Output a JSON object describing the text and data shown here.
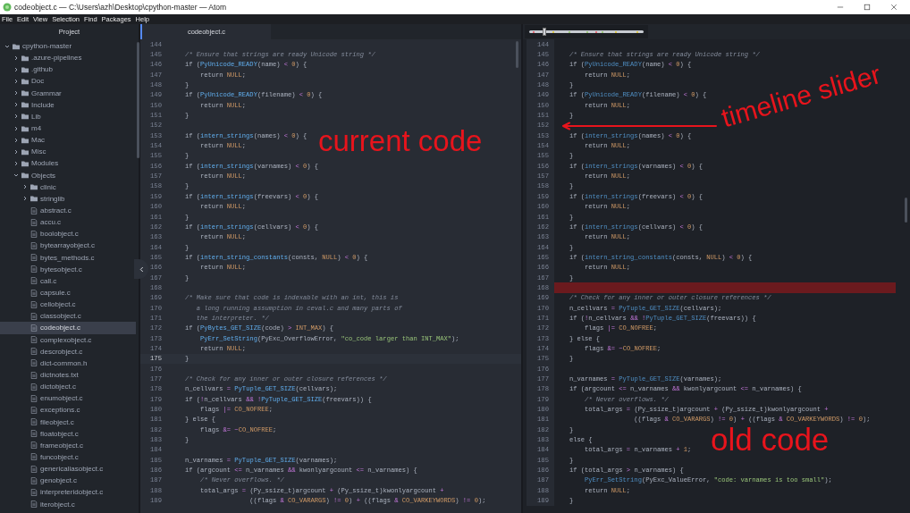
{
  "window": {
    "title": "codeobject.c — C:\\Users\\azh\\Desktop\\cpython-master — Atom"
  },
  "menu": [
    "File",
    "Edit",
    "View",
    "Selection",
    "Find",
    "Packages",
    "Help"
  ],
  "sidebar": {
    "title": "Project",
    "tree": [
      {
        "name": "cpython-master",
        "kind": "folder",
        "expanded": true,
        "selected": false,
        "children": [
          {
            "name": ".azure-pipelines",
            "kind": "folder",
            "expanded": false,
            "selected": false
          },
          {
            "name": ".github",
            "kind": "folder",
            "expanded": false,
            "selected": false
          },
          {
            "name": "Doc",
            "kind": "folder",
            "expanded": false,
            "selected": false
          },
          {
            "name": "Grammar",
            "kind": "folder",
            "expanded": false,
            "selected": false
          },
          {
            "name": "Include",
            "kind": "folder",
            "expanded": false,
            "selected": false
          },
          {
            "name": "Lib",
            "kind": "folder",
            "expanded": false,
            "selected": false
          },
          {
            "name": "m4",
            "kind": "folder",
            "expanded": false,
            "selected": false
          },
          {
            "name": "Mac",
            "kind": "folder",
            "expanded": false,
            "selected": false
          },
          {
            "name": "Misc",
            "kind": "folder",
            "expanded": false,
            "selected": false
          },
          {
            "name": "Modules",
            "kind": "folder",
            "expanded": false,
            "selected": false
          },
          {
            "name": "Objects",
            "kind": "folder",
            "expanded": true,
            "selected": false,
            "children": [
              {
                "name": "clinic",
                "kind": "folder",
                "expanded": false,
                "selected": false
              },
              {
                "name": "stringlib",
                "kind": "folder",
                "expanded": false,
                "selected": false
              },
              {
                "name": "abstract.c",
                "kind": "file",
                "selected": false
              },
              {
                "name": "accu.c",
                "kind": "file",
                "selected": false
              },
              {
                "name": "boolobject.c",
                "kind": "file",
                "selected": false
              },
              {
                "name": "bytearrayobject.c",
                "kind": "file",
                "selected": false
              },
              {
                "name": "bytes_methods.c",
                "kind": "file",
                "selected": false
              },
              {
                "name": "bytesobject.c",
                "kind": "file",
                "selected": false
              },
              {
                "name": "call.c",
                "kind": "file",
                "selected": false
              },
              {
                "name": "capsule.c",
                "kind": "file",
                "selected": false
              },
              {
                "name": "cellobject.c",
                "kind": "file",
                "selected": false
              },
              {
                "name": "classobject.c",
                "kind": "file",
                "selected": false
              },
              {
                "name": "codeobject.c",
                "kind": "file",
                "selected": true
              },
              {
                "name": "complexobject.c",
                "kind": "file",
                "selected": false
              },
              {
                "name": "descrobject.c",
                "kind": "file",
                "selected": false
              },
              {
                "name": "dict-common.h",
                "kind": "file",
                "selected": false
              },
              {
                "name": "dictnotes.txt",
                "kind": "file",
                "selected": false
              },
              {
                "name": "dictobject.c",
                "kind": "file",
                "selected": false
              },
              {
                "name": "enumobject.c",
                "kind": "file",
                "selected": false
              },
              {
                "name": "exceptions.c",
                "kind": "file",
                "selected": false
              },
              {
                "name": "fileobject.c",
                "kind": "file",
                "selected": false
              },
              {
                "name": "floatobject.c",
                "kind": "file",
                "selected": false
              },
              {
                "name": "frameobject.c",
                "kind": "file",
                "selected": false
              },
              {
                "name": "funcobject.c",
                "kind": "file",
                "selected": false
              },
              {
                "name": "genericaliasobject.c",
                "kind": "file",
                "selected": false
              },
              {
                "name": "genobject.c",
                "kind": "file",
                "selected": false
              },
              {
                "name": "interpreteridobject.c",
                "kind": "file",
                "selected": false
              },
              {
                "name": "iterobject.c",
                "kind": "file",
                "selected": false
              }
            ]
          }
        ]
      }
    ]
  },
  "editor": {
    "tab": "codeobject.c",
    "lines": [
      {
        "n": "144",
        "kind": "blank",
        "current": false
      },
      {
        "n": "145",
        "kind": "comment",
        "text": "/* Ensure that strings are ready Unicode string */",
        "current": false
      },
      {
        "n": "146",
        "kind": "code",
        "text": "if (PyUnicode_READY(name) < 0) {",
        "current": false
      },
      {
        "n": "147",
        "kind": "code",
        "text": "    return NULL;",
        "current": false
      },
      {
        "n": "148",
        "kind": "code",
        "text": "}",
        "current": false
      },
      {
        "n": "149",
        "kind": "code",
        "text": "if (PyUnicode_READY(filename) < 0) {",
        "current": false
      },
      {
        "n": "150",
        "kind": "code",
        "text": "    return NULL;",
        "current": false
      },
      {
        "n": "151",
        "kind": "code",
        "text": "}",
        "current": false
      },
      {
        "n": "152",
        "kind": "blank",
        "current": false
      },
      {
        "n": "153",
        "kind": "code",
        "text": "if (intern_strings(names) < 0) {",
        "current": false
      },
      {
        "n": "154",
        "kind": "code",
        "text": "    return NULL;",
        "current": false
      },
      {
        "n": "155",
        "kind": "code",
        "text": "}",
        "current": false
      },
      {
        "n": "156",
        "kind": "code",
        "text": "if (intern_strings(varnames) < 0) {",
        "current": false
      },
      {
        "n": "157",
        "kind": "code",
        "text": "    return NULL;",
        "current": false
      },
      {
        "n": "158",
        "kind": "code",
        "text": "}",
        "current": false
      },
      {
        "n": "159",
        "kind": "code",
        "text": "if (intern_strings(freevars) < 0) {",
        "current": false
      },
      {
        "n": "160",
        "kind": "code",
        "text": "    return NULL;",
        "current": false
      },
      {
        "n": "161",
        "kind": "code",
        "text": "}",
        "current": false
      },
      {
        "n": "162",
        "kind": "code",
        "text": "if (intern_strings(cellvars) < 0) {",
        "current": false
      },
      {
        "n": "163",
        "kind": "code",
        "text": "    return NULL;",
        "current": false
      },
      {
        "n": "164",
        "kind": "code",
        "text": "}",
        "current": false
      },
      {
        "n": "165",
        "kind": "code",
        "text": "if (intern_string_constants(consts, NULL) < 0) {",
        "current": false
      },
      {
        "n": "166",
        "kind": "code",
        "text": "    return NULL;",
        "current": false
      },
      {
        "n": "167",
        "kind": "code",
        "text": "}",
        "current": false
      },
      {
        "n": "168",
        "kind": "blank",
        "current": false
      },
      {
        "n": "169",
        "kind": "comment",
        "text": "/* Make sure that code is indexable with an int, this is",
        "current": false
      },
      {
        "n": "170",
        "kind": "comment",
        "text": "   a long running assumption in ceval.c and many parts of",
        "current": false
      },
      {
        "n": "171",
        "kind": "comment",
        "text": "   the interpreter. */",
        "current": false
      },
      {
        "n": "172",
        "kind": "code",
        "text": "if (PyBytes_GET_SIZE(code) > INT_MAX) {",
        "current": false
      },
      {
        "n": "173",
        "kind": "code",
        "text": "    PyErr_SetString(PyExc_OverflowError, \"co_code larger than INT_MAX\");",
        "current": false
      },
      {
        "n": "174",
        "kind": "code",
        "text": "    return NULL;",
        "current": false
      },
      {
        "n": "175",
        "kind": "code",
        "text": "}",
        "current": true
      },
      {
        "n": "176",
        "kind": "blank",
        "current": false
      },
      {
        "n": "177",
        "kind": "comment",
        "text": "/* Check for any inner or outer closure references */",
        "current": false
      },
      {
        "n": "178",
        "kind": "code",
        "text": "n_cellvars = PyTuple_GET_SIZE(cellvars);",
        "current": false
      },
      {
        "n": "179",
        "kind": "code",
        "text": "if (!n_cellvars && !PyTuple_GET_SIZE(freevars)) {",
        "current": false
      },
      {
        "n": "180",
        "kind": "code",
        "text": "    flags |= CO_NOFREE;",
        "current": false
      },
      {
        "n": "181",
        "kind": "code",
        "text": "} else {",
        "current": false
      },
      {
        "n": "182",
        "kind": "code",
        "text": "    flags &= ~CO_NOFREE;",
        "current": false
      },
      {
        "n": "183",
        "kind": "code",
        "text": "}",
        "current": false
      },
      {
        "n": "184",
        "kind": "blank",
        "current": false
      },
      {
        "n": "185",
        "kind": "code",
        "text": "n_varnames = PyTuple_GET_SIZE(varnames);",
        "current": false
      },
      {
        "n": "186",
        "kind": "code",
        "text": "if (argcount <= n_varnames && kwonlyargcount <= n_varnames) {",
        "current": false
      },
      {
        "n": "187",
        "kind": "comment",
        "text": "    /* Never overflows. */",
        "current": false
      },
      {
        "n": "188",
        "kind": "code",
        "text": "    total_args = (Py_ssize_t)argcount + (Py_ssize_t)kwonlyargcount +",
        "current": false
      },
      {
        "n": "189",
        "kind": "code",
        "text": "                 ((flags & CO_VARARGS) != 0) + ((flags & CO_VARKEYWORDS) != 0);",
        "current": false
      }
    ]
  },
  "history": {
    "timeline": {
      "level": 0.13
    },
    "lines": [
      {
        "n": "144",
        "kind": "blank",
        "changed": false
      },
      {
        "n": "145",
        "kind": "comment",
        "text": "/* Ensure that strings are ready Unicode string */",
        "changed": false
      },
      {
        "n": "146",
        "kind": "code",
        "text": "if (PyUnicode_READY(name) < 0) {",
        "changed": false
      },
      {
        "n": "147",
        "kind": "code",
        "text": "    return NULL;",
        "changed": false
      },
      {
        "n": "148",
        "kind": "code",
        "text": "}",
        "changed": false
      },
      {
        "n": "149",
        "kind": "code",
        "text": "if (PyUnicode_READY(filename) < 0) {",
        "changed": false
      },
      {
        "n": "150",
        "kind": "code",
        "text": "    return NULL;",
        "changed": false
      },
      {
        "n": "151",
        "kind": "code",
        "text": "}",
        "changed": false
      },
      {
        "n": "152",
        "kind": "blank",
        "changed": false
      },
      {
        "n": "153",
        "kind": "code",
        "text": "if (intern_strings(names) < 0) {",
        "changed": false
      },
      {
        "n": "154",
        "kind": "code",
        "text": "    return NULL;",
        "changed": false
      },
      {
        "n": "155",
        "kind": "code",
        "text": "}",
        "changed": false
      },
      {
        "n": "156",
        "kind": "code",
        "text": "if (intern_strings(varnames) < 0) {",
        "changed": false
      },
      {
        "n": "157",
        "kind": "code",
        "text": "    return NULL;",
        "changed": false
      },
      {
        "n": "158",
        "kind": "code",
        "text": "}",
        "changed": false
      },
      {
        "n": "159",
        "kind": "code",
        "text": "if (intern_strings(freevars) < 0) {",
        "changed": false
      },
      {
        "n": "160",
        "kind": "code",
        "text": "    return NULL;",
        "changed": false
      },
      {
        "n": "161",
        "kind": "code",
        "text": "}",
        "changed": false
      },
      {
        "n": "162",
        "kind": "code",
        "text": "if (intern_strings(cellvars) < 0) {",
        "changed": false
      },
      {
        "n": "163",
        "kind": "code",
        "text": "    return NULL;",
        "changed": false
      },
      {
        "n": "164",
        "kind": "code",
        "text": "}",
        "changed": false
      },
      {
        "n": "165",
        "kind": "code",
        "text": "if (intern_string_constants(consts, NULL) < 0) {",
        "changed": false
      },
      {
        "n": "166",
        "kind": "code",
        "text": "    return NULL;",
        "changed": false
      },
      {
        "n": "167",
        "kind": "code",
        "text": "}",
        "changed": false
      },
      {
        "n": "168",
        "kind": "blank",
        "changed": true
      },
      {
        "n": "169",
        "kind": "comment",
        "text": "/* Check for any inner or outer closure references */",
        "changed": false
      },
      {
        "n": "170",
        "kind": "code",
        "text": "n_cellvars = PyTuple_GET_SIZE(cellvars);",
        "changed": false
      },
      {
        "n": "171",
        "kind": "code",
        "text": "if (!n_cellvars && !PyTuple_GET_SIZE(freevars)) {",
        "changed": false
      },
      {
        "n": "172",
        "kind": "code",
        "text": "    flags |= CO_NOFREE;",
        "changed": false
      },
      {
        "n": "173",
        "kind": "code",
        "text": "} else {",
        "changed": false
      },
      {
        "n": "174",
        "kind": "code",
        "text": "    flags &= ~CO_NOFREE;",
        "changed": false
      },
      {
        "n": "175",
        "kind": "code",
        "text": "}",
        "changed": false
      },
      {
        "n": "176",
        "kind": "blank",
        "changed": false
      },
      {
        "n": "177",
        "kind": "code",
        "text": "n_varnames = PyTuple_GET_SIZE(varnames);",
        "changed": false
      },
      {
        "n": "178",
        "kind": "code",
        "text": "if (argcount <= n_varnames && kwonlyargcount <= n_varnames) {",
        "changed": false
      },
      {
        "n": "179",
        "kind": "comment",
        "text": "    /* Never overflows. */",
        "changed": false
      },
      {
        "n": "180",
        "kind": "code",
        "text": "    total_args = (Py_ssize_t)argcount + (Py_ssize_t)kwonlyargcount +",
        "changed": false
      },
      {
        "n": "181",
        "kind": "code",
        "text": "                 ((flags & CO_VARARGS) != 0) + ((flags & CO_VARKEYWORDS) != 0);",
        "changed": false
      },
      {
        "n": "182",
        "kind": "code",
        "text": "}",
        "changed": false
      },
      {
        "n": "183",
        "kind": "code",
        "text": "else {",
        "changed": false
      },
      {
        "n": "184",
        "kind": "code",
        "text": "    total_args = n_varnames + 1;",
        "changed": false
      },
      {
        "n": "185",
        "kind": "code",
        "text": "}",
        "changed": false
      },
      {
        "n": "186",
        "kind": "code",
        "text": "if (total_args > n_varnames) {",
        "changed": false
      },
      {
        "n": "187",
        "kind": "code",
        "text": "    PyErr_SetString(PyExc_ValueError, \"code: varnames is too small\");",
        "changed": false
      },
      {
        "n": "188",
        "kind": "code",
        "text": "    return NULL;",
        "changed": false
      },
      {
        "n": "189",
        "kind": "code",
        "text": "}",
        "changed": false
      }
    ]
  },
  "annotations": [
    {
      "text": "current code"
    },
    {
      "text": "timeline slider"
    },
    {
      "text": "old code"
    }
  ]
}
